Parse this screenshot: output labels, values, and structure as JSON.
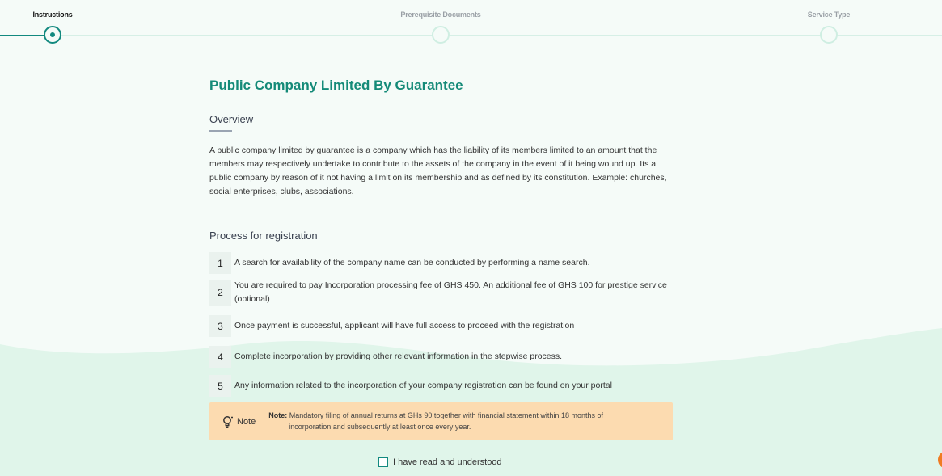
{
  "stepper": {
    "steps": [
      {
        "label": "Instructions",
        "state": "active"
      },
      {
        "label": "Prerequisite Documents",
        "state": "inactive"
      },
      {
        "label": "Service Type",
        "state": "inactive"
      }
    ]
  },
  "main": {
    "title": "Public Company Limited By Guarantee",
    "overview_heading": "Overview",
    "overview_text": "A public company limited by guarantee is a company which has the liability of its members limited to an amount that the members may respectively undertake to contribute to the assets of the company in the event of it being wound up. Its a public company by reason of it not having a limit on its membership and as defined by its constitution. Example: churches, social enterprises, clubs, associations.",
    "process_heading": "Process for registration",
    "process_steps": [
      {
        "num": "1",
        "text": "A search for availability of the company name can be conducted by performing a name search."
      },
      {
        "num": "2",
        "text": "You are required to pay Incorporation processing fee of GHS 450. An additional fee of GHS 100 for prestige service (optional)"
      },
      {
        "num": "3",
        "text": "Once payment is successful, applicant will have full access to proceed with the registration"
      },
      {
        "num": "4",
        "text": "Complete incorporation by providing other relevant information in the stepwise process."
      },
      {
        "num": "5",
        "text": "Any information related to the incorporation of your company registration can be found on your portal"
      }
    ],
    "note": {
      "icon": "lightbulb-icon",
      "label": "Note",
      "prefix": "Note:",
      "line1": "Mandatory filing of annual returns at GHs 90 together with financial statement within 18 months of",
      "line2": "incorporation and subsequently at least once every year."
    },
    "agree_label": "I have read and understood"
  },
  "colors": {
    "accent": "#12897f",
    "title": "#148a78",
    "note_bg": "#fcdbb0",
    "fab": "#f07b22"
  }
}
